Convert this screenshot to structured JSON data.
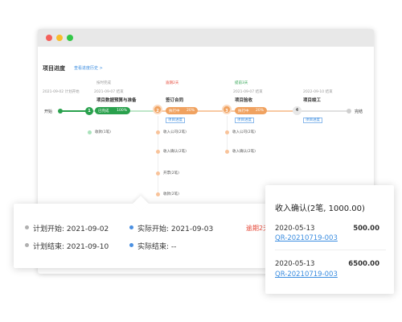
{
  "window": {
    "page_title": "项目进度",
    "history_link": "查看进度历史 >"
  },
  "timeline": {
    "start_label": "开始",
    "end_label": "完结",
    "start_plan": "2021-09-02 计划开始",
    "stages": [
      {
        "index": "1",
        "name": "项目数据预算与准备",
        "plan": "2021-09-07 结束",
        "tag": "按时完成",
        "progress_label": "已完成",
        "progress_value": "100%",
        "sub_items": [
          "收款(1笔)"
        ]
      },
      {
        "index": "2",
        "name": "签订合同",
        "tag": "逾期2天",
        "progress_label": "执行中",
        "progress_value": "20%",
        "action": "项目进度",
        "sub_items": [
          "收入公司(2笔)",
          "收入确认(2笔)",
          "开票(2笔)",
          "收款(2笔)"
        ]
      },
      {
        "index": "3",
        "name": "项目验收",
        "plan": "2021-09-07 结束",
        "tag": "提前3天",
        "progress_label": "执行中",
        "progress_value": "20%",
        "action": "项目进度",
        "sub_items": [
          "收入公司(2笔)",
          "收入确认(2笔)"
        ]
      },
      {
        "index": "4",
        "name": "项目竣工",
        "plan": "2022-09-10 结束",
        "action": "项目进度"
      }
    ]
  },
  "detail": {
    "plan_start_label": "计划开始:",
    "plan_start_value": "2021-09-02",
    "actual_start_label": "实际开始:",
    "actual_start_value": "2021-09-03",
    "delay": "逾期2天",
    "plan_end_label": "计划结束:",
    "plan_end_value": "2021-09-10",
    "actual_end_label": "实际结束:",
    "actual_end_value": "--"
  },
  "income": {
    "title": "收入确认(2笔, 1000.00)",
    "entries": [
      {
        "date": "2020-05-13",
        "amount": "500.00",
        "link": "QR-20210719-003"
      },
      {
        "date": "2020-05-13",
        "amount": "6500.00",
        "link": "QR-20210719-003"
      }
    ]
  },
  "colors": {
    "green": "#2aa14d",
    "orange": "#f0a260",
    "link_blue": "#3b8de0",
    "delay_red": "#e64a3a"
  }
}
